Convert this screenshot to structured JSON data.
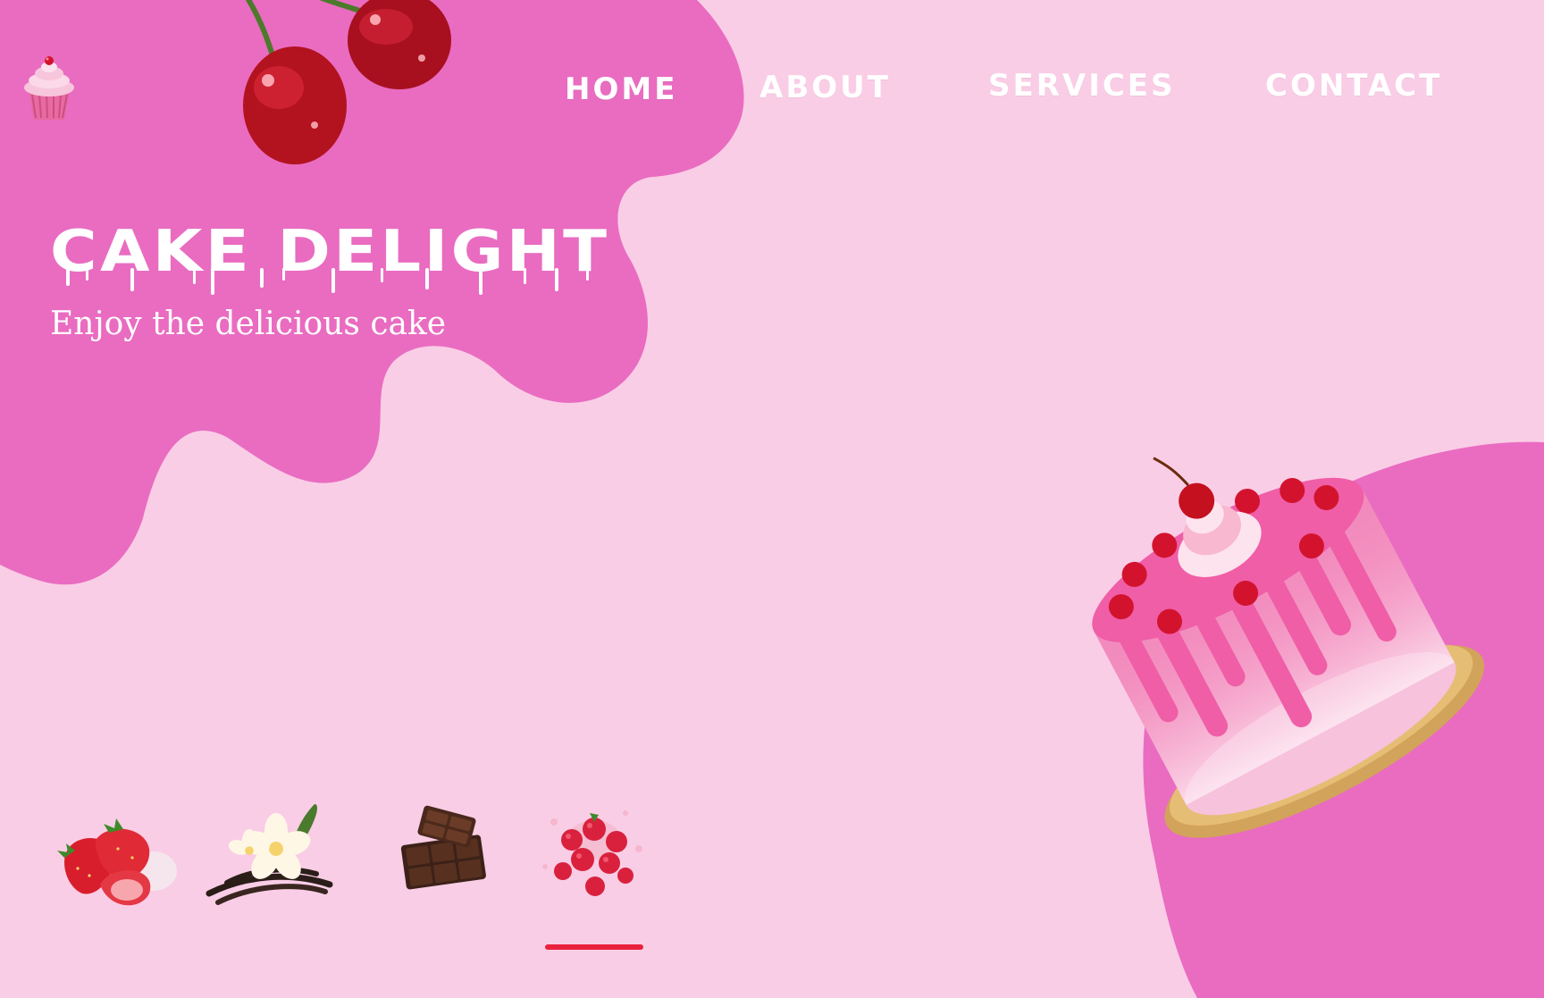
{
  "brand": {
    "logo_icon": "cupcake-icon"
  },
  "nav": {
    "items": [
      {
        "label": "HOME"
      },
      {
        "label": "ABOUT"
      },
      {
        "label": "SERVICES"
      },
      {
        "label": "CONTACT"
      }
    ],
    "active": "HOME"
  },
  "hero": {
    "title": "CAKE DELIGHT",
    "subtitle": "Enjoy the delicious cake",
    "decor_icon": "cherries-icon",
    "image_icon": "drip-cake-icon"
  },
  "flavors": {
    "items": [
      {
        "icon": "strawberry-icon"
      },
      {
        "icon": "vanilla-flower-icon"
      },
      {
        "icon": "chocolate-icon"
      },
      {
        "icon": "raspberry-icon"
      }
    ],
    "selected_index": 3
  },
  "colors": {
    "background": "#facde6",
    "accent_pink": "#e96cc1",
    "indicator": "#e8213d",
    "text": "#ffffff"
  }
}
